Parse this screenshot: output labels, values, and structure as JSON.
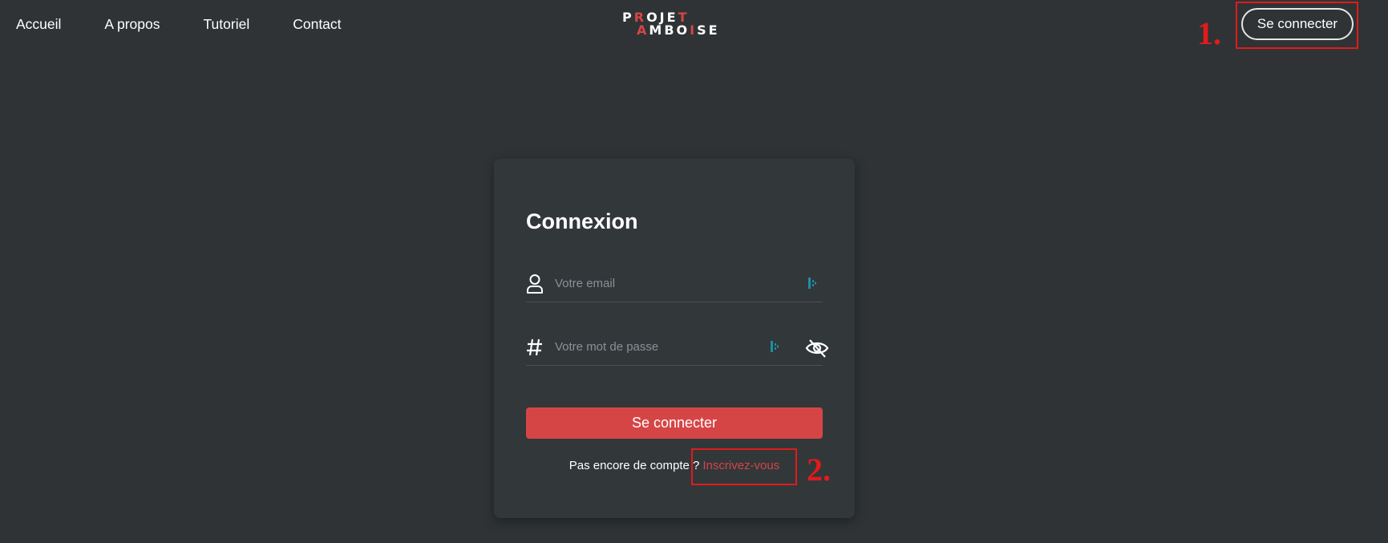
{
  "nav": {
    "links": [
      "Accueil",
      "A propos",
      "Tutoriel",
      "Contact"
    ],
    "logo": {
      "line1": "PROJET",
      "line2": "AMBOISE"
    },
    "connect_label": "Se connecter"
  },
  "annotations": {
    "first": "1.",
    "second": "2."
  },
  "login": {
    "title": "Connexion",
    "email_placeholder": "Votre email",
    "email_value": "",
    "password_placeholder": "Votre mot de passe",
    "password_value": "",
    "submit_label": "Se connecter",
    "signup_prompt": "Pas encore de compte ?",
    "signup_link": "Inscrivez-vous"
  },
  "colors": {
    "background": "#2f3335",
    "card": "#32373a",
    "accent": "#d64545",
    "annotation": "#e11b1b",
    "extension_icon": "#1f8fa3"
  },
  "icons": {
    "email": "user-icon",
    "password": "hash-icon",
    "toggle_password": "eye-off-icon",
    "autofill": "password-manager-icon"
  }
}
